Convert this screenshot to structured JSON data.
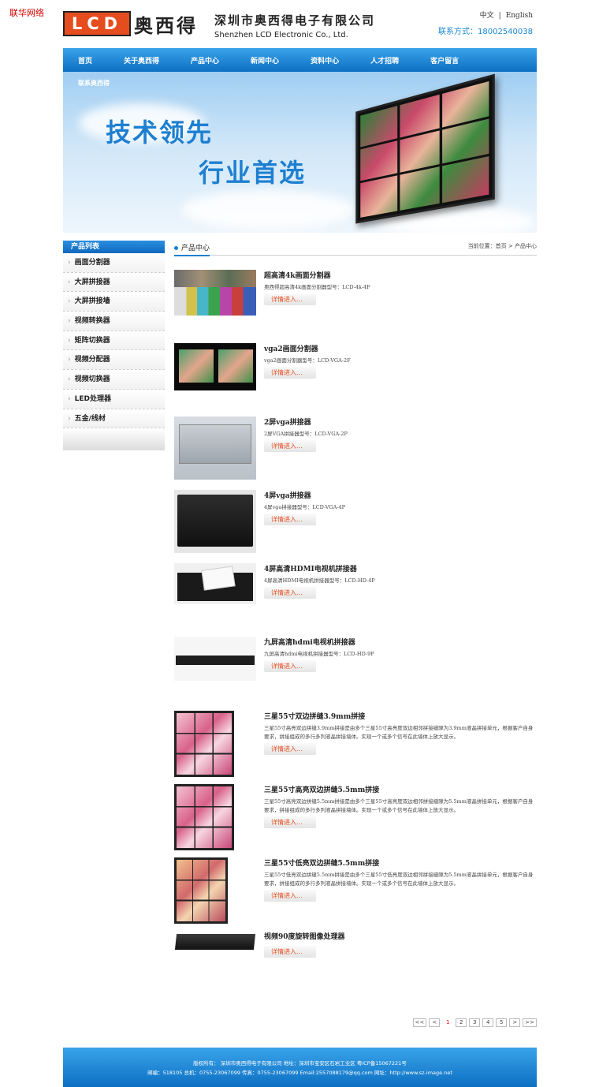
{
  "corner_text": "联华网络",
  "header": {
    "logo_text": "LCD",
    "logo_cn": "奥西得",
    "company_cn": "深圳市奥西得电子有限公司",
    "company_en": "Shenzhen LCD Electronic  Co., Ltd.",
    "lang_cn": "中文",
    "lang_sep": "|",
    "lang_en": "English",
    "contact": "联系方式：18002540038"
  },
  "nav": {
    "items": [
      "首页",
      "关于奥西得",
      "产品中心",
      "新闻中心",
      "资料中心",
      "人才招聘",
      "客户留言"
    ]
  },
  "banner": {
    "subtitle": "联系奥西得",
    "slogan1": "技术领先",
    "slogan2": "行业首选"
  },
  "sidebar": {
    "title": "产品列表",
    "items": [
      "画面分割器",
      "大屏拼接器",
      "大屏拼接墙",
      "视频转换器",
      "矩阵切换器",
      "视频分配器",
      "视频切换器",
      "LED处理器",
      "五金/线材"
    ]
  },
  "content": {
    "title": "产品中心",
    "breadcrumb": "当前位置：首页 > 产品中心"
  },
  "products": [
    {
      "title": "超高清4k画面分割器",
      "desc": "奥西得超高清4k画面分割器型号：LCD-4k-4F",
      "button": "详情进入..."
    },
    {
      "title": "vga2画面分割器",
      "desc": "vga2画面分割器型号：LCD-VGA-2F",
      "button": "详情进入..."
    },
    {
      "title": "2屏vga拼接器",
      "desc": "2屏VGA拼接器型号：LCD-VGA-2P",
      "button": "详情进入..."
    },
    {
      "title": "4屏vga拼接器",
      "desc": "4屏vga拼接器型号：LCD-VGA-4P",
      "button": "详情进入..."
    },
    {
      "title": "4屏高清HDMI电视机拼接器",
      "desc": "4屏高清HDMI电视机拼接器型号：LCD-HD-4P",
      "button": "详情进入..."
    },
    {
      "title": "九屏高清hdmi电视机拼接器",
      "desc": "九屏高清hdmi电视机拼接器型号：LCD-HD-9P",
      "button": "详情进入..."
    },
    {
      "title": "三星55寸双边拼缝3.9mm拼接",
      "desc": "三星55寸高亮双边拼缝3.9mm拼接是由多个三星55寸高亮度双边相邻拼接缝隙为3.9mm液晶拼接单元，根据客户自身要求，拼接组成的多行多列液晶拼接墙体。实现一个或多个信号在此墙体上放大显示。",
      "button": "详情进入..."
    },
    {
      "title": "三星55寸高亮双边拼缝5.5mm拼接",
      "desc": "三星55寸高亮双边拼缝5.5mm拼接是由多个三星55寸高亮度双边相邻拼接缝隙为5.5mm液晶拼接单元，根据客户自身要求，拼接组成的多行多列液晶拼接墙体。实现一个或多个信号在此墙体上放大显示。",
      "button": "详情进入..."
    },
    {
      "title": "三星55寸低亮双边拼缝5.5mm拼接",
      "desc": "三星55寸低亮双边拼缝5.5mm拼接是由多个三星55寸低亮度双边相邻拼接缝隙为5.5mm液晶拼接单元，根据客户自身要求，拼接组成的多行多列液晶拼接墙体。实现一个或多个信号在此墙体上放大显示。",
      "button": "详情进入..."
    },
    {
      "title": "视频90度旋转图像处理器",
      "desc": "",
      "button": "详情进入..."
    }
  ],
  "pagination": {
    "first": "<<",
    "prev": "<",
    "pages": [
      "1",
      "2",
      "3",
      "4",
      "5"
    ],
    "next": ">",
    "last": ">>",
    "current": "1"
  },
  "footer": {
    "line1": "版权所有： 深圳市奥西得电子有限公司 地址：深圳市宝安区石岩工业区 粤ICP备15067221号",
    "line2": "邮编：518105 总机：0755-23067099 传真：0755-23067099 Email:2557088179@qq.com 网址：http://www.sz-image.net"
  },
  "colors": {
    "brand_orange": "#e54d1f",
    "nav_blue": "#1a7fd6",
    "accent_red": "#d10000"
  }
}
